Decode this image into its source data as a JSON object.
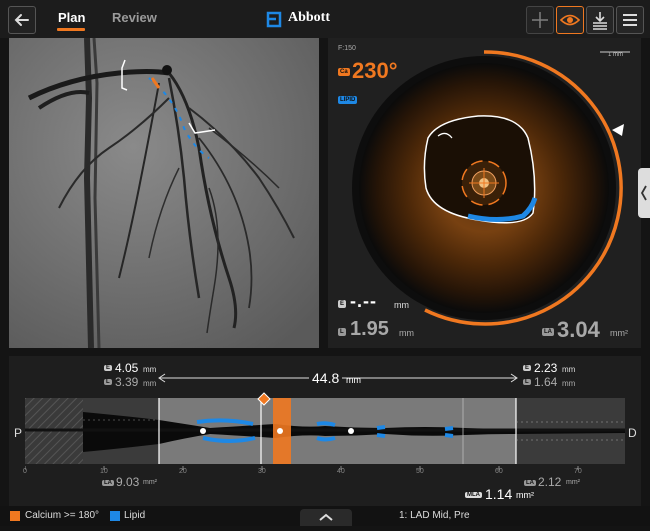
{
  "header": {
    "tabs": [
      {
        "label": "Plan"
      },
      {
        "label": "Review"
      }
    ],
    "brand": "Abbott"
  },
  "oct": {
    "frame": "F:150",
    "calcium_tag": "Ca",
    "calcium_angle": "230°",
    "lipid_tag": "LIPID",
    "scale_label": "1 mm",
    "e_tag": "E",
    "e_value": "-.--",
    "e_unit": "mm",
    "l_tag": "L",
    "l_value": "1.95",
    "l_unit": "mm",
    "la_tag": "LA",
    "la_value": "3.04",
    "la_unit": "mm²"
  },
  "longitudinal": {
    "proximal_label": "P",
    "distal_label": "D",
    "left_ref": {
      "e_tag": "E",
      "e_value": "4.05",
      "e_unit": "mm",
      "l_tag": "L",
      "l_value": "3.39",
      "l_unit": "mm",
      "la_tag": "LA",
      "la_value": "9.03",
      "la_unit": "mm²"
    },
    "right_ref": {
      "e_tag": "E",
      "e_value": "2.23",
      "e_unit": "mm",
      "l_tag": "L",
      "l_value": "1.64",
      "l_unit": "mm",
      "la_tag": "LA",
      "la_value": "2.12",
      "la_unit": "mm²"
    },
    "length_value": "44.8",
    "length_unit": "mm",
    "mla_tag": "MLA",
    "mla_value": "1.14",
    "mla_unit": "mm²",
    "axis_ticks": [
      "0",
      "10",
      "20",
      "30",
      "40",
      "50",
      "60",
      "70"
    ]
  },
  "footer": {
    "legend": [
      {
        "label": "Calcium >= 180°",
        "color": "#f07820"
      },
      {
        "label": "Lipid",
        "color": "#1e88e5"
      }
    ],
    "vessel_label": "1: LAD Mid, Pre",
    "expand_icon": "chevron-up-icon"
  },
  "colors": {
    "accent": "#f07820",
    "lipid": "#1e88e5"
  }
}
